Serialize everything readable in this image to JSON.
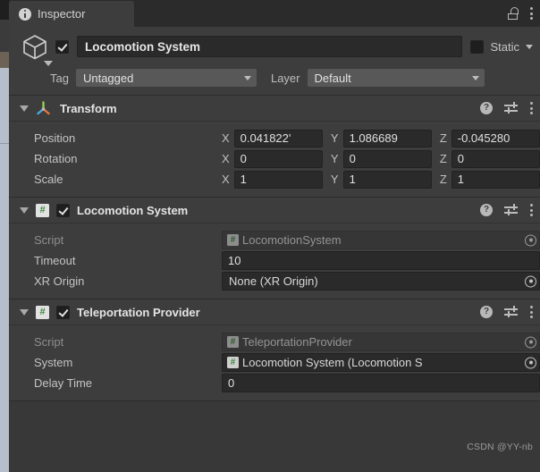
{
  "window": {
    "tab_label": "Inspector",
    "tab_icon": "info-icon",
    "lock_icon": "lock-open-icon",
    "menu_icon": "kebab-menu-icon"
  },
  "gameobject": {
    "icon": "cube-icon",
    "enabled": true,
    "name": "Locomotion System",
    "static_label": "Static",
    "static_checked": false,
    "tag_label": "Tag",
    "tag_value": "Untagged",
    "layer_label": "Layer",
    "layer_value": "Default"
  },
  "components": [
    {
      "title": "Transform",
      "icon": "transform-gizmo-icon",
      "has_enable_checkbox": false,
      "expanded": true,
      "help_icon": "help-icon",
      "preset_icon": "preset-icon",
      "menu_icon": "kebab-menu-icon",
      "rows": [
        {
          "label": "Position",
          "type": "vector3",
          "x": "0.041822'",
          "y": "1.086689",
          "z": "-0.045280"
        },
        {
          "label": "Rotation",
          "type": "vector3",
          "x": "0",
          "y": "0",
          "z": "0"
        },
        {
          "label": "Scale",
          "type": "vector3",
          "x": "1",
          "y": "1",
          "z": "1"
        }
      ]
    },
    {
      "title": "Locomotion System",
      "icon": "script-icon",
      "has_enable_checkbox": true,
      "enabled": true,
      "expanded": true,
      "rows": [
        {
          "label": "Script",
          "type": "object",
          "value": "LocomotionSystem",
          "disabled": true,
          "badge": true
        },
        {
          "label": "Timeout",
          "type": "text",
          "value": "10"
        },
        {
          "label": "XR Origin",
          "type": "object",
          "value": "None (XR Origin)",
          "disabled": false,
          "badge": false
        }
      ]
    },
    {
      "title": "Teleportation Provider",
      "icon": "script-icon",
      "has_enable_checkbox": true,
      "enabled": true,
      "expanded": true,
      "rows": [
        {
          "label": "Script",
          "type": "object",
          "value": "TeleportationProvider",
          "disabled": true,
          "badge": true
        },
        {
          "label": "System",
          "type": "object",
          "value": "Locomotion System (Locomotion S",
          "disabled": false,
          "badge": true
        },
        {
          "label": "Delay Time",
          "type": "text",
          "value": "0"
        }
      ]
    }
  ],
  "axes": {
    "x": "X",
    "y": "Y",
    "z": "Z"
  },
  "help_glyph": "?",
  "watermark": "CSDN @YY-nb",
  "colors": {
    "panel": "#383838",
    "header": "#3d3d3d",
    "field": "#2a2a2a",
    "accent_green": "#3f8a3f"
  }
}
